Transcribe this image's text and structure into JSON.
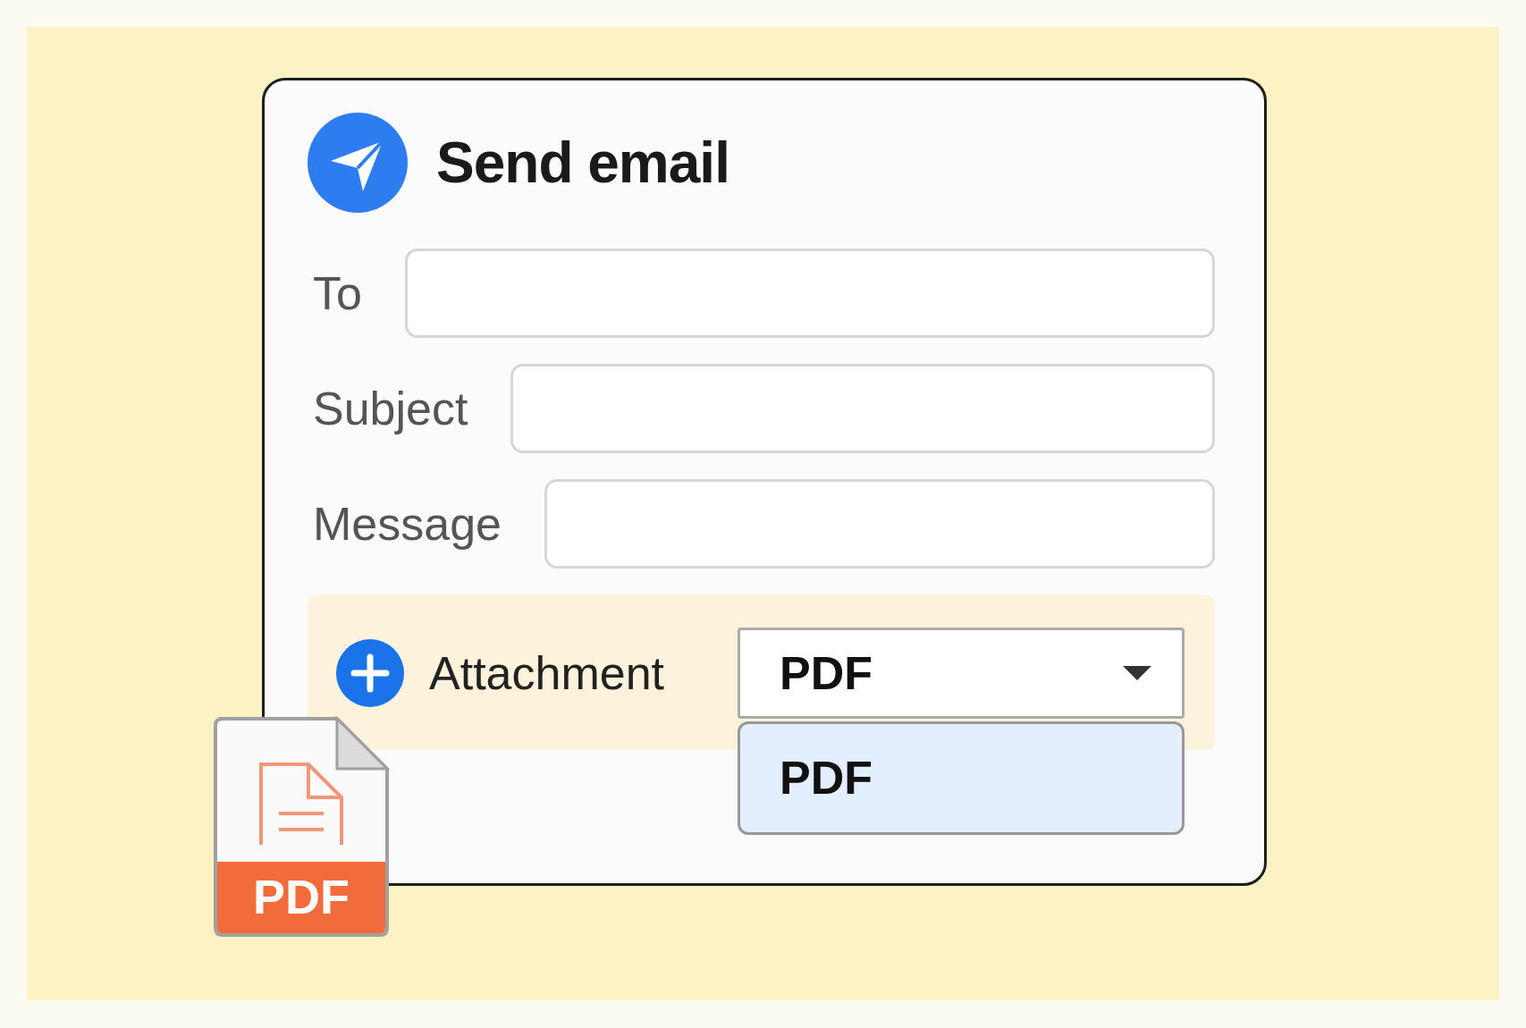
{
  "dialog": {
    "title": "Send email",
    "fields": [
      {
        "label": "To"
      },
      {
        "label": "Subject"
      },
      {
        "label": "Message"
      }
    ],
    "attachment": {
      "label": "Attachment",
      "select": {
        "value": "PDF",
        "expanded": true,
        "options": [
          {
            "label": "PDF",
            "selected": true
          }
        ]
      }
    },
    "file_icon": {
      "label": "PDF"
    }
  }
}
